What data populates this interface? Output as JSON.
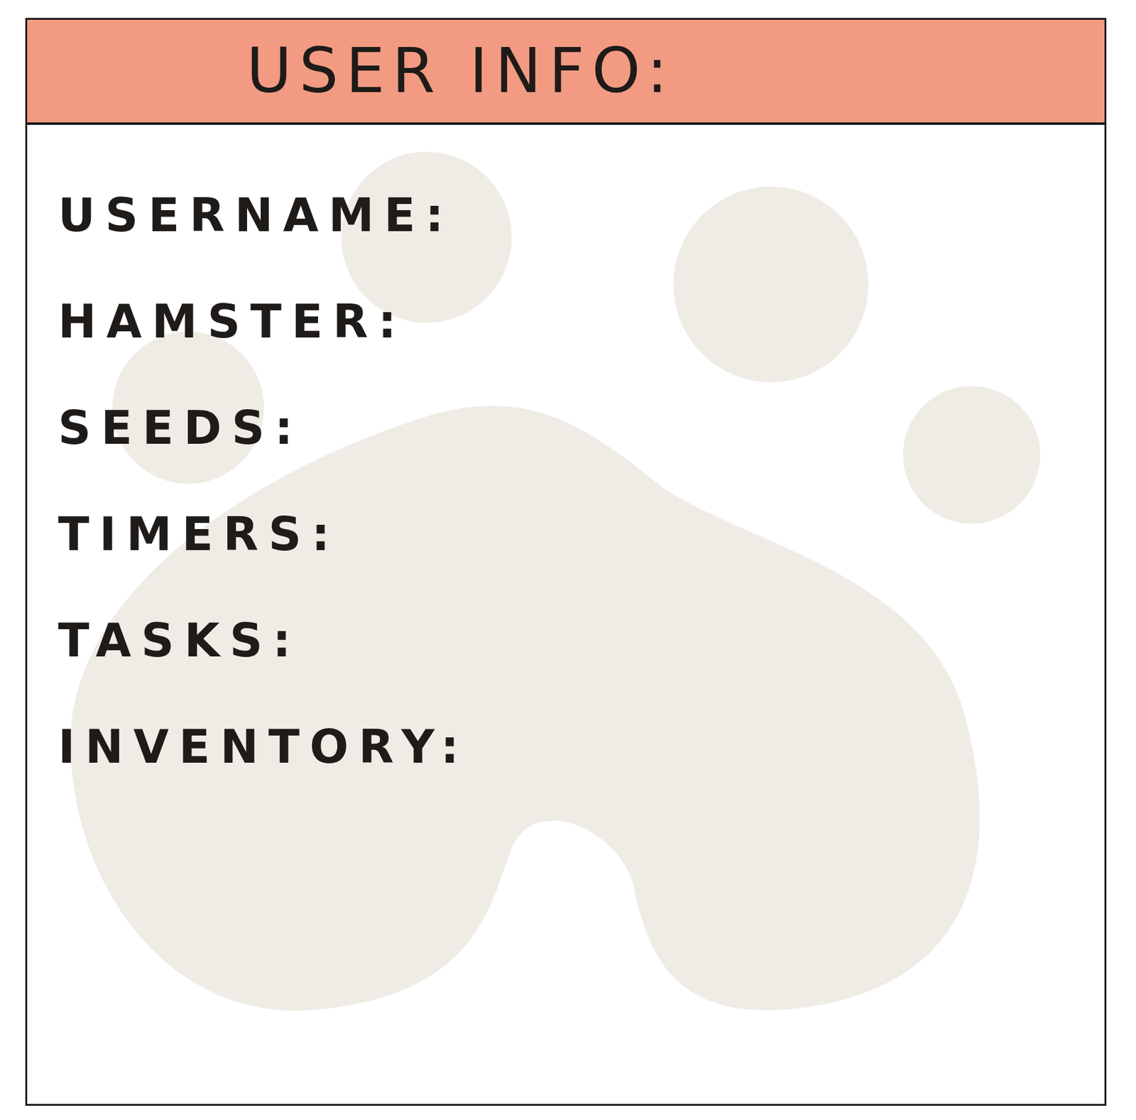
{
  "header": {
    "title": "USER INFO:"
  },
  "fields": [
    {
      "label": "USERNAME:"
    },
    {
      "label": "HAMSTER:"
    },
    {
      "label": "SEEDS:"
    },
    {
      "label": "TIMERS:"
    },
    {
      "label": "TASKS:"
    },
    {
      "label": "INVENTORY:"
    }
  ]
}
